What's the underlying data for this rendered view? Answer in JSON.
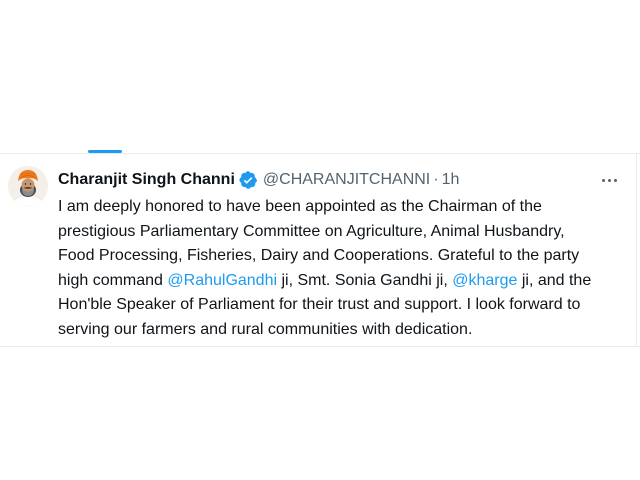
{
  "tweet": {
    "display_name": "Charanjit Singh Channi",
    "verified_icon": "verified-badge-icon",
    "handle": "@CHARANJITCHANNI",
    "separator": "·",
    "timestamp": "1h",
    "more_icon": "more-horizontal-icon",
    "text_lines": [
      {
        "segments": [
          {
            "text": "I am deeply honored to have been appointed as the Chairman of the"
          }
        ]
      },
      {
        "segments": [
          {
            "text": "prestigious Parliamentary Committee on Agriculture, Animal Husbandry,"
          }
        ]
      },
      {
        "segments": [
          {
            "text": "Food Processing, Fisheries, Dairy and Cooperations. Grateful to the party"
          }
        ]
      },
      {
        "segments": [
          {
            "text": "high command "
          },
          {
            "text": "@RahulGandhi"
          },
          {
            "text": " ji, Smt. Sonia Gandhi ji, "
          },
          {
            "text": "@kharge"
          },
          {
            "text": " ji, and the"
          }
        ]
      },
      {
        "segments": [
          {
            "text": "Hon'ble Speaker of Parliament for their trust and support. I look forward to"
          }
        ]
      },
      {
        "segments": [
          {
            "text": "serving our farmers and rural communities with dedication."
          }
        ]
      }
    ]
  },
  "colors": {
    "accent": "#1d9bf0",
    "text": "#0f1419",
    "muted": "#536471",
    "border": "#e6ecf0"
  }
}
